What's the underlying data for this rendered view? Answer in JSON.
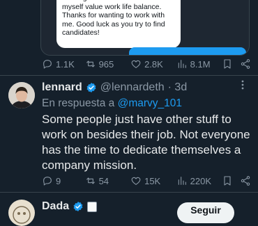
{
  "quoted_chat": {
    "lines": "this is great a match for me as I\nmyself value work life balance.\nThanks for wanting to work with\nme. Good luck as you try to find\ncandidates!"
  },
  "tweet1": {
    "actions": {
      "replies": "1.1K",
      "retweets": "965",
      "likes": "2.8K",
      "views": "8.1M"
    }
  },
  "tweet2": {
    "name": "lennard",
    "handle": "@lennardeth",
    "time": "· 3d",
    "reply_prefix": "En respuesta a",
    "reply_handle": "@marvy_101",
    "text": "Some people just have other stuff to work on besides their job. Not everyone has the time to dedicate themselves a company mission.",
    "actions": {
      "replies": "9",
      "retweets": "54",
      "likes": "15K",
      "views": "220K"
    }
  },
  "tweet3": {
    "name": "Dada",
    "follow_label": "Seguir"
  },
  "colors": {
    "background": "#15202b",
    "accent": "#1d9bf0",
    "muted": "#8b98a5"
  }
}
